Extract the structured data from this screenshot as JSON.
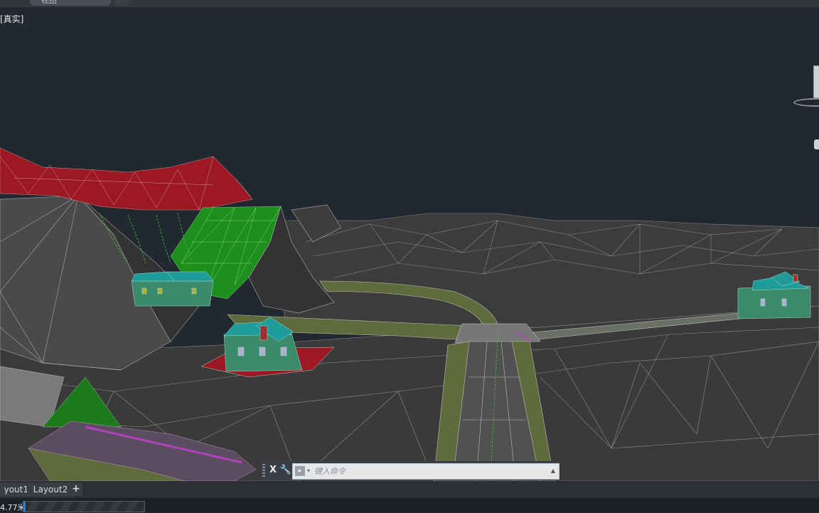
{
  "document_tab": {
    "label": "视图"
  },
  "viewport": {
    "view_style_label": "[真实]",
    "viewcube_label": "",
    "colors": {
      "background": "#212830",
      "terrain": "#3b3b3b",
      "terrain_light": "#4a4a4a",
      "wire": "#c8c8c8",
      "red_slope": "#a5141e",
      "green_slope": "#1f8a1f",
      "road": "#5f6b3c",
      "magenta": "#c83fd0",
      "house_wall": "#3c8a6c",
      "house_roof": "#1f9c9a"
    }
  },
  "command_line": {
    "close_icon": "close-icon",
    "close_glyph": "X",
    "customize_icon": "wrench-icon",
    "customize_glyph": "🔧",
    "placeholder": "键入命令",
    "history_glyph": "▲"
  },
  "layout_tabs": [
    {
      "label": "yout1"
    },
    {
      "label": "Layout2"
    }
  ],
  "add_tab_glyph": "+",
  "status": {
    "distance_text": "4.77米",
    "progress_fraction": 0.02
  }
}
